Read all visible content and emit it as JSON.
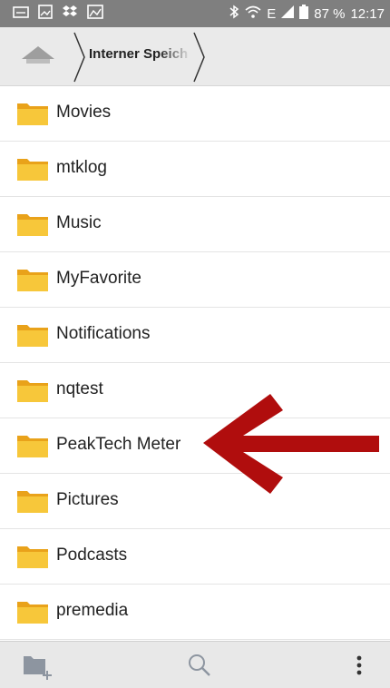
{
  "status_bar": {
    "battery": "87 %",
    "time": "12:17",
    "network": "E"
  },
  "path_bar": {
    "home_icon": "home-icon",
    "folder_label": "Interner Speich"
  },
  "folders": [
    {
      "name": "Movies"
    },
    {
      "name": "mtklog"
    },
    {
      "name": "Music"
    },
    {
      "name": "MyFavorite"
    },
    {
      "name": "Notifications"
    },
    {
      "name": "nqtest"
    },
    {
      "name": "PeakTech Meter"
    },
    {
      "name": "Pictures"
    },
    {
      "name": "Podcasts"
    },
    {
      "name": "premedia"
    }
  ],
  "toolbar": {
    "new_folder_icon": "new-folder-icon",
    "search_icon": "search-icon",
    "more_icon": "more-options-icon"
  },
  "colors": {
    "status_bar": "#7f7f7f",
    "path_bar": "#eaeaea",
    "folder": "#f5c02b",
    "arrow": "#b00d0d",
    "toolbar": "#e8e8e8"
  }
}
